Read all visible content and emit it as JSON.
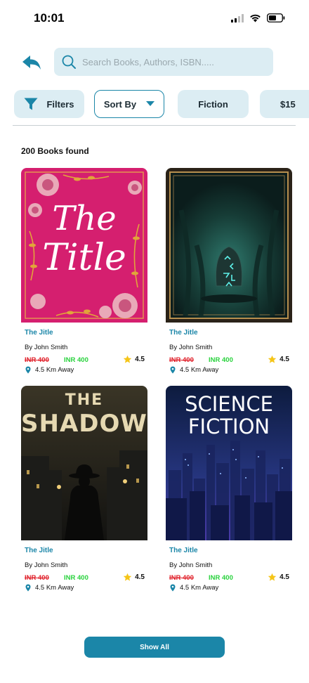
{
  "status_bar": {
    "time": "10:01"
  },
  "search": {
    "placeholder": "Search Books, Authors, ISBN....."
  },
  "chips": {
    "filters": "Filters",
    "sort": "Sort By",
    "fiction": "Fiction",
    "price": "$15"
  },
  "results": {
    "count_label": "200 Books found"
  },
  "books": [
    {
      "cover_text": [
        "The",
        "Title"
      ],
      "title": "The Jitle",
      "author": "By John Smith",
      "price_old": "INR 400",
      "price_new": "INR 400",
      "rating": "4.5",
      "distance": "4.5 Km Away"
    },
    {
      "cover_text": [],
      "title": "The Jitle",
      "author": "By John Smith",
      "price_old": "INR 400",
      "price_new": "INR 400",
      "rating": "4.5",
      "distance": "4.5 Km Away"
    },
    {
      "cover_text": [
        "THE",
        "SHADOW"
      ],
      "title": "The Jitle",
      "author": "By John Smith",
      "price_old": "INR 400",
      "price_new": "INR 400",
      "rating": "4.5",
      "distance": "4.5 Km Away"
    },
    {
      "cover_text": [
        "SCIENCE",
        "FICTION"
      ],
      "title": "The Jitle",
      "author": "By John Smith",
      "price_old": "INR 400",
      "price_new": "INR 400",
      "rating": "4.5",
      "distance": "4.5 Km Away"
    }
  ],
  "footer": {
    "show_all": "Show All"
  },
  "colors": {
    "accent": "#1b86a8",
    "chip_bg": "#dcedf3",
    "price_old": "#e0202a",
    "price_new": "#28d23c",
    "star": "#f5c518"
  }
}
